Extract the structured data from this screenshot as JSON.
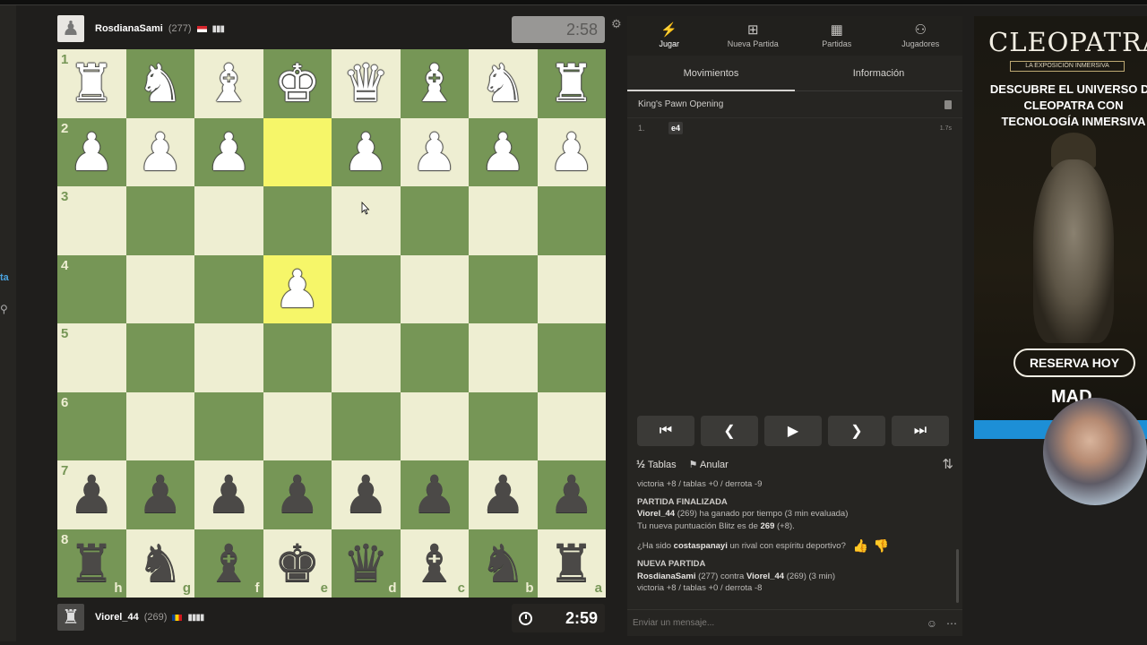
{
  "left_edge": {
    "fragment": "ta"
  },
  "top_player": {
    "name": "RosdianaSami",
    "rating": "(277)",
    "clock": "2:58"
  },
  "bottom_player": {
    "name": "Viorel_44",
    "rating": "(269)",
    "clock": "2:59"
  },
  "board": {
    "rank_labels": [
      "1",
      "2",
      "3",
      "4",
      "5",
      "6",
      "7",
      "8"
    ],
    "file_labels": [
      "h",
      "g",
      "f",
      "e",
      "d",
      "c",
      "b",
      "a"
    ],
    "last_move_from": "e2",
    "last_move_to": "e4"
  },
  "nav": {
    "tabs": [
      {
        "label": "Jugar",
        "icon": "lightning-icon",
        "active": true
      },
      {
        "label": "Nueva Partida",
        "icon": "plus-icon"
      },
      {
        "label": "Partidas",
        "icon": "board-icon"
      },
      {
        "label": "Jugadores",
        "icon": "players-icon"
      }
    ]
  },
  "subtabs": {
    "moves": "Movimientos",
    "info": "Información"
  },
  "opening": "King's Pawn Opening",
  "moves": [
    {
      "num": "1.",
      "white": "e4",
      "time": "1.7s"
    }
  ],
  "actions": {
    "draw_icon": "½",
    "draw": "Tablas",
    "abort": "Anular"
  },
  "chat": {
    "line1": "victoria +8 / tablas +0 / derrota -9",
    "finished_header": "PARTIDA FINALIZADA",
    "winner": "Viorel_44",
    "winner_rating": "(269)",
    "winner_text": "ha ganado por tiempo (3 min evaluada)",
    "score_text": "Tu nueva puntuación Blitz es de",
    "score_value": "269",
    "score_delta": "(+8).",
    "sport_q1": "¿Ha sido",
    "sport_name": "costaspanayi",
    "sport_q2": "un rival con espíritu deportivo?",
    "new_header": "NUEVA PARTIDA",
    "p1": "RosdianaSami",
    "p1_rating": "(277)",
    "vs": "contra",
    "p2": "Viorel_44",
    "p2_rating": "(269) (3 min)",
    "line_last": "victoria +8 / tablas +0 / derrota -8",
    "input_placeholder": "Enviar un mensaje..."
  },
  "ad": {
    "logo": "CLEOPATRA",
    "tag": "LA EXPOSICIÓN INMERSIVA",
    "headline": "DESCUBRE EL UNIVERSO DE CLEOPATRA CON TECNOLOGÍA INMERSIVA",
    "cta": "RESERVA HOY",
    "city": "MAD"
  }
}
